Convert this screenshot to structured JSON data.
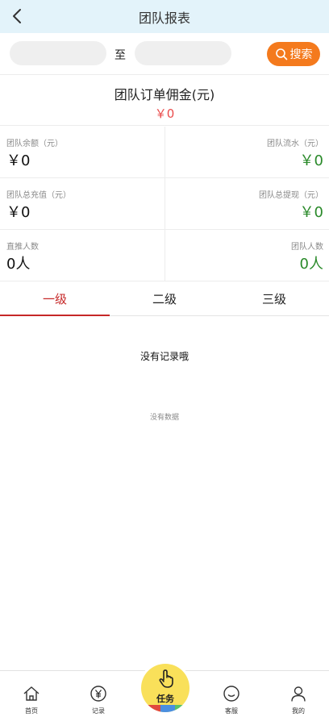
{
  "header": {
    "title": "团队报表"
  },
  "search": {
    "start_value": "",
    "to_label": "至",
    "end_value": "",
    "button_label": "搜索"
  },
  "commission": {
    "label": "团队订单佣金(元)",
    "value": "￥0"
  },
  "stats": {
    "balance": {
      "label": "团队余额（元）",
      "value": "￥0"
    },
    "flow": {
      "label": "团队流水（元）",
      "value": "￥0"
    },
    "recharge": {
      "label": "团队总充值（元）",
      "value": "￥0"
    },
    "withdraw": {
      "label": "团队总提现（元）",
      "value": "￥0"
    },
    "direct": {
      "label": "直推人数",
      "value": "0人"
    },
    "team_size": {
      "label": "团队人数",
      "value": "0人"
    }
  },
  "tabs": [
    {
      "label": "一级",
      "active": true
    },
    {
      "label": "二级",
      "active": false
    },
    {
      "label": "三级",
      "active": false
    }
  ],
  "empty": {
    "message": "没有记录哦",
    "no_data": "没有数据"
  },
  "nav": {
    "home": "首页",
    "records": "记录",
    "task": "任务",
    "service": "客服",
    "mine": "我的"
  },
  "colors": {
    "header_bg": "#e3f3fa",
    "accent_orange": "#f47a1d",
    "commission_red": "#ea4b4b",
    "positive_green": "#2a8a2a",
    "active_tab": "#c62828",
    "task_yellow": "#f9e05a"
  },
  "icons": {
    "back": "chevron-left-icon",
    "search": "search-icon",
    "home": "home-icon",
    "records": "yen-circle-icon",
    "task": "pointing-hand-icon",
    "service": "smile-icon",
    "mine": "user-icon"
  }
}
